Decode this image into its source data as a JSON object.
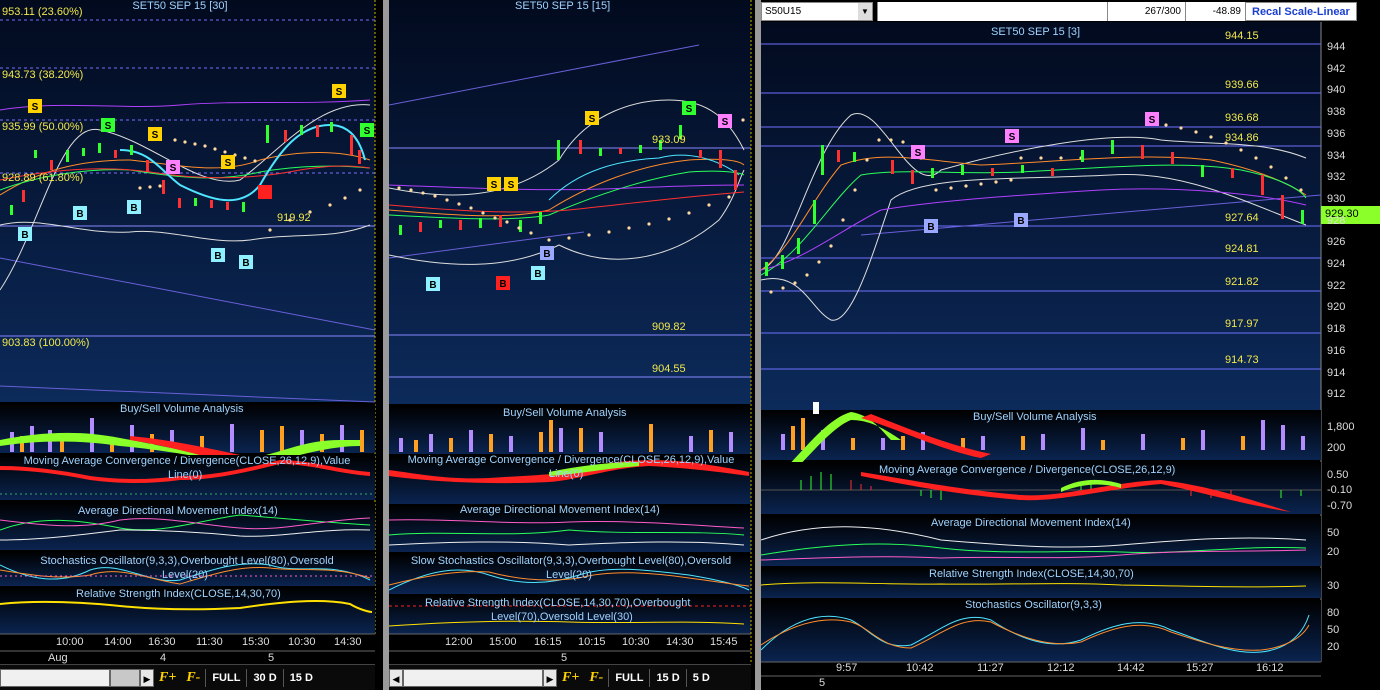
{
  "left": {
    "title": "SET50 SEP 15   [30]",
    "fib_labels": [
      "953.11 (23.60%)",
      "943.73 (38.20%)",
      "935.99 (50.00%)",
      "928.89 (61.80%)",
      "903.83 (100.00%)"
    ],
    "price_label": "919.92",
    "indicators": [
      "Buy/Sell Volume Analysis",
      "Moving Average Convergence / Divergence(CLOSE,26,12,9),Value",
      "Line(0)",
      "Average Directional Movement Index(14)",
      "Stochastics Oscillator(9,3,3),Overbought Level(80),Oversold",
      "Level(20)",
      "Relative Strength Index(CLOSE,14,30,70)"
    ],
    "time_labels": [
      "10:00",
      "14:00",
      "16:30",
      "11:30",
      "15:30",
      "10:30",
      "14:30"
    ],
    "date_labels": [
      "Aug",
      "4",
      "5"
    ],
    "toolbar": [
      "FULL",
      "30 D",
      "15 D"
    ]
  },
  "middle": {
    "title": "SET50 SEP 15   [15]",
    "price_labels": [
      "933.09",
      "909.82",
      "904.55"
    ],
    "indicators": [
      "Buy/Sell Volume Analysis",
      "Moving Average Convergence / Divergence(CLOSE,26,12,9),Value",
      "Line(0)",
      "Average Directional Movement Index(14)",
      "Slow Stochastics Oscillator(9,3,3),Overbought Level(80),Oversold",
      "Level(20)",
      "Relative Strength Index(CLOSE,14,30,70),Overbought",
      "Level(70),Oversold Level(30)"
    ],
    "time_labels": [
      "12:00",
      "15:00",
      "16:15",
      "10:15",
      "10:30",
      "14:30",
      "15:45"
    ],
    "date_labels": [
      "5"
    ],
    "toolbar": [
      "FULL",
      "15 D",
      "5 D"
    ]
  },
  "right": {
    "symbol": "S50U15",
    "counter": "267/300",
    "change": "-48.89",
    "recal_button": "Recal Scale-Linear",
    "title": "SET50 SEP 15   [3]",
    "price_levels": [
      "944.15",
      "939.66",
      "936.68",
      "934.86",
      "927.64",
      "924.81",
      "921.82",
      "917.97",
      "914.73"
    ],
    "last_price": "929.30",
    "y_ticks": [
      "944",
      "942",
      "940",
      "938",
      "936",
      "934",
      "932",
      "930",
      "928",
      "926",
      "924",
      "922",
      "920",
      "918",
      "916",
      "914",
      "912"
    ],
    "volume_ticks": [
      "1,800",
      "200"
    ],
    "macd_ticks": [
      "0.50",
      "-0.10",
      "-0.70"
    ],
    "adx_ticks": [
      "50",
      "20"
    ],
    "rsi_ticks": [
      "30"
    ],
    "stoch_ticks": [
      "80",
      "50",
      "20"
    ],
    "indicators": [
      "Buy/Sell Volume Analysis",
      "Moving Average Convergence / Divergence(CLOSE,26,12,9)",
      "Average Directional Movement Index(14)",
      "Relative Strength Index(CLOSE,14,30,70)",
      "Stochastics Oscillator(9,3,3)"
    ],
    "time_labels": [
      "9:57",
      "10:42",
      "11:27",
      "12:12",
      "14:42",
      "15:27",
      "16:12"
    ],
    "date_labels": [
      "5"
    ]
  },
  "markers": {
    "sell": "S",
    "buy": "B"
  },
  "colors": {
    "buy_up": "#9dff3a",
    "sell_down": "#ff2020",
    "fib": "#f2e84a",
    "label": "#9fd3ff"
  }
}
